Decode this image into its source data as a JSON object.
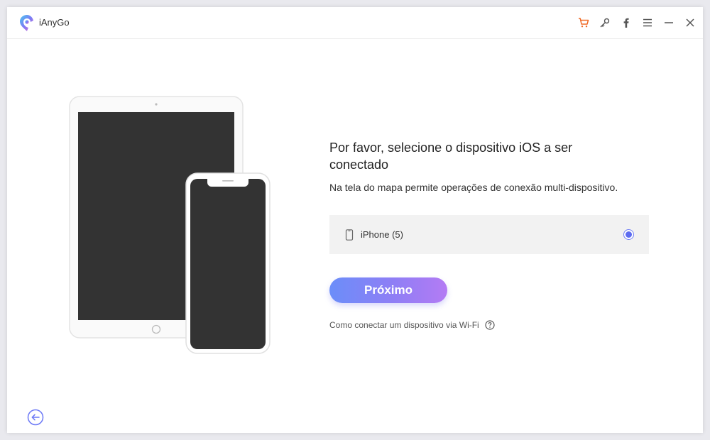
{
  "app": {
    "title": "iAnyGo",
    "accent_color": "#6b78f6"
  },
  "titlebar": {
    "icons": [
      "cart-icon",
      "key-icon",
      "facebook-icon",
      "menu-icon",
      "minimize-icon",
      "close-icon"
    ]
  },
  "main": {
    "heading": "Por favor, selecione o dispositivo iOS a ser conectado",
    "subtext": "Na tela do mapa permite operações de conexão multi-dispositivo.",
    "devices": [
      {
        "label": "iPhone (5)",
        "selected": true
      }
    ],
    "next_button": "Próximo",
    "wifi_link": "Como conectar um dispositivo via Wi-Fi"
  }
}
